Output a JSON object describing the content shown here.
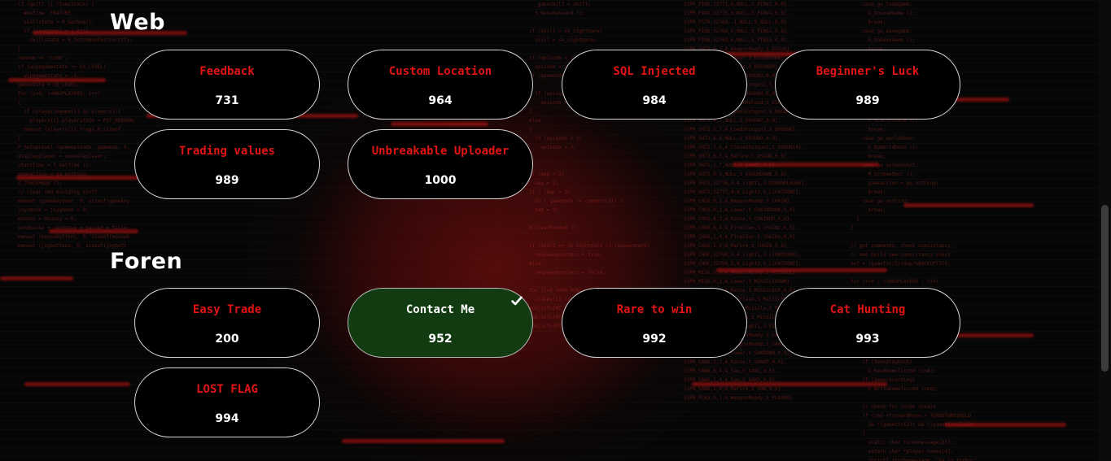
{
  "categories": [
    {
      "title": "Web",
      "challenges": [
        {
          "name": "Feedback",
          "points": "731",
          "solved": false
        },
        {
          "name": "Custom Location",
          "points": "964",
          "solved": false
        },
        {
          "name": "SQL Injected",
          "points": "984",
          "solved": false
        },
        {
          "name": "Beginner's Luck",
          "points": "989",
          "solved": false
        },
        {
          "name": "Trading values",
          "points": "989",
          "solved": false
        },
        {
          "name": "Unbreakable Uploader",
          "points": "1000",
          "solved": false
        }
      ]
    },
    {
      "title": "Foren",
      "challenges": [
        {
          "name": "Easy Trade",
          "points": "200",
          "solved": false
        },
        {
          "name": "Contact Me",
          "points": "952",
          "solved": true
        },
        {
          "name": "Rare to win",
          "points": "992",
          "solved": false
        },
        {
          "name": "Cat Hunting",
          "points": "993",
          "solved": false
        },
        {
          "name": "LOST FLAG",
          "points": "994",
          "solved": false
        }
      ]
    }
  ],
  "colors": {
    "accent_red": "#e21414",
    "solved_green": "#123b12",
    "card_border": "#d8d8d8",
    "text_white": "#ffffff"
  },
  "icons": {
    "solved": "checkmark-icon"
  }
}
